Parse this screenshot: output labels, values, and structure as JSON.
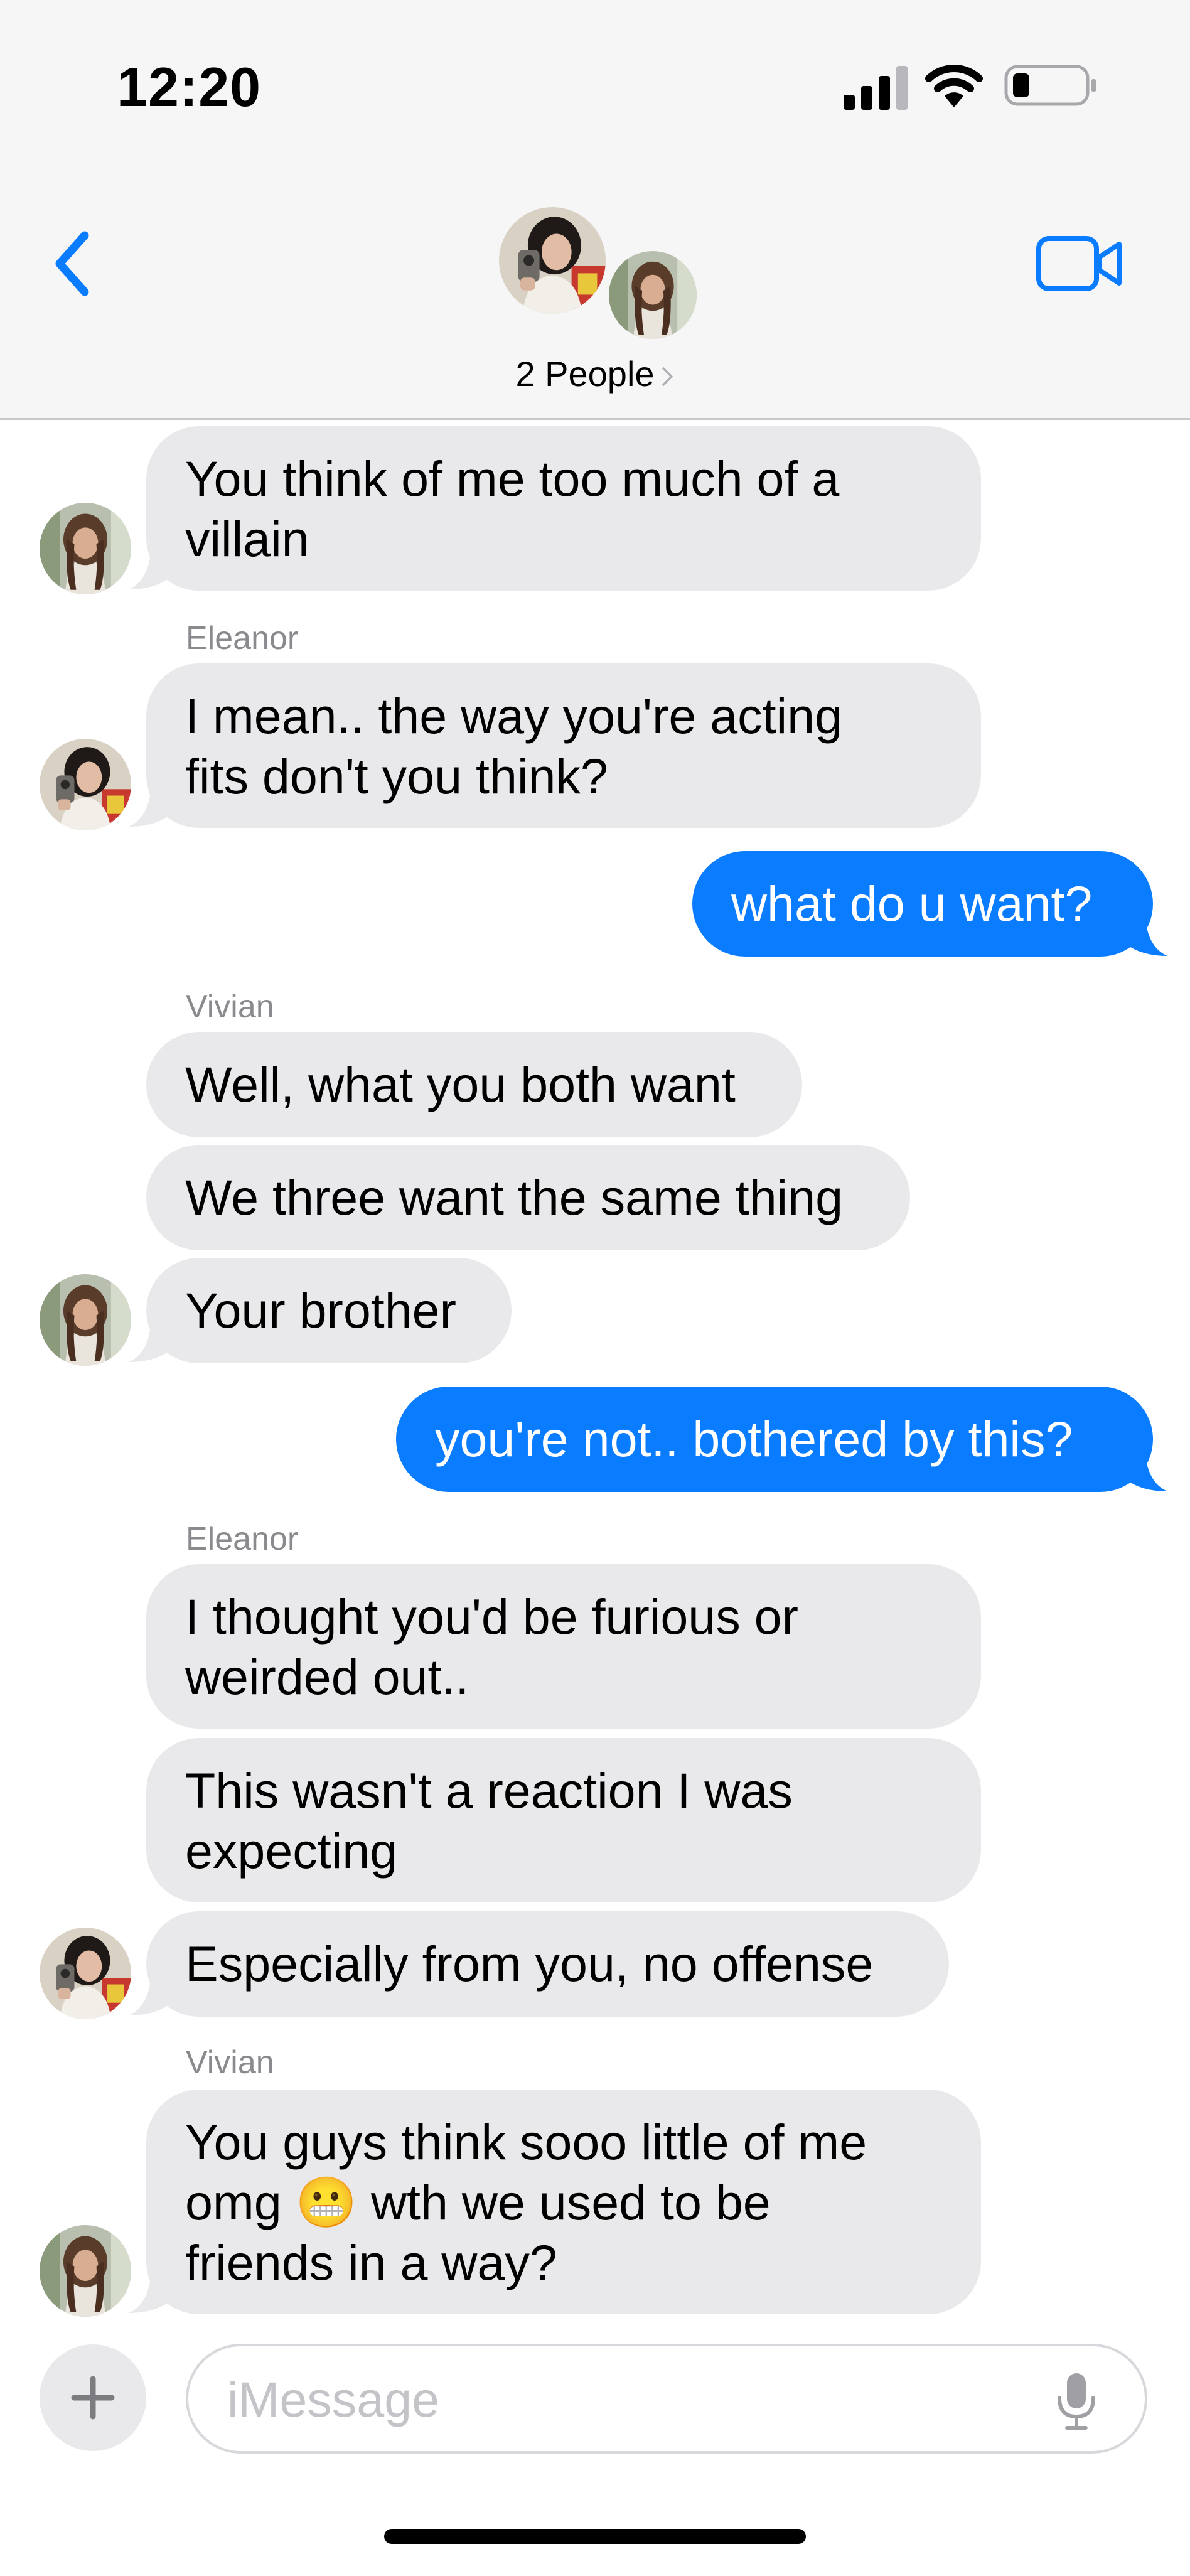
{
  "status_bar": {
    "time": "12:20",
    "signal_icon": "cellular-signal-icon",
    "wifi_icon": "wifi-icon",
    "battery_icon": "battery-low-icon"
  },
  "header": {
    "back_icon": "chevron-left-icon",
    "video_icon": "video-camera-icon",
    "people_label": "2 People",
    "accent_color": "#0a7cff"
  },
  "messages": [
    {
      "text": "You think of me too much of a\nvillain"
    },
    {
      "sender": "Eleanor"
    },
    {
      "text": "I mean.. the way you're acting\nfits don't you think?"
    },
    {
      "text": "what do u want?"
    },
    {
      "sender": "Vivian"
    },
    {
      "text": "Well, what you both want"
    },
    {
      "text": "We three want the same thing"
    },
    {
      "text": "Your brother"
    },
    {
      "text": "you're not.. bothered by this?"
    },
    {
      "sender": "Eleanor"
    },
    {
      "text": "I thought you'd be furious or\nweirded out.."
    },
    {
      "text": "This wasn't a reaction I was\nexpecting"
    },
    {
      "text": "Especially from you, no offense"
    },
    {
      "sender": "Vivian"
    },
    {
      "text": "You guys think sooo little of me\nomg 😬 wth we used to be\nfriends in a way?"
    }
  ],
  "input_bar": {
    "placeholder": "iMessage",
    "plus_icon": "plus-icon",
    "mic_icon": "microphone-icon"
  },
  "colors": {
    "incoming_bubble": "#e9e9eb",
    "outgoing_bubble": "#0a7cff",
    "header_bg": "#f6f6f6"
  }
}
